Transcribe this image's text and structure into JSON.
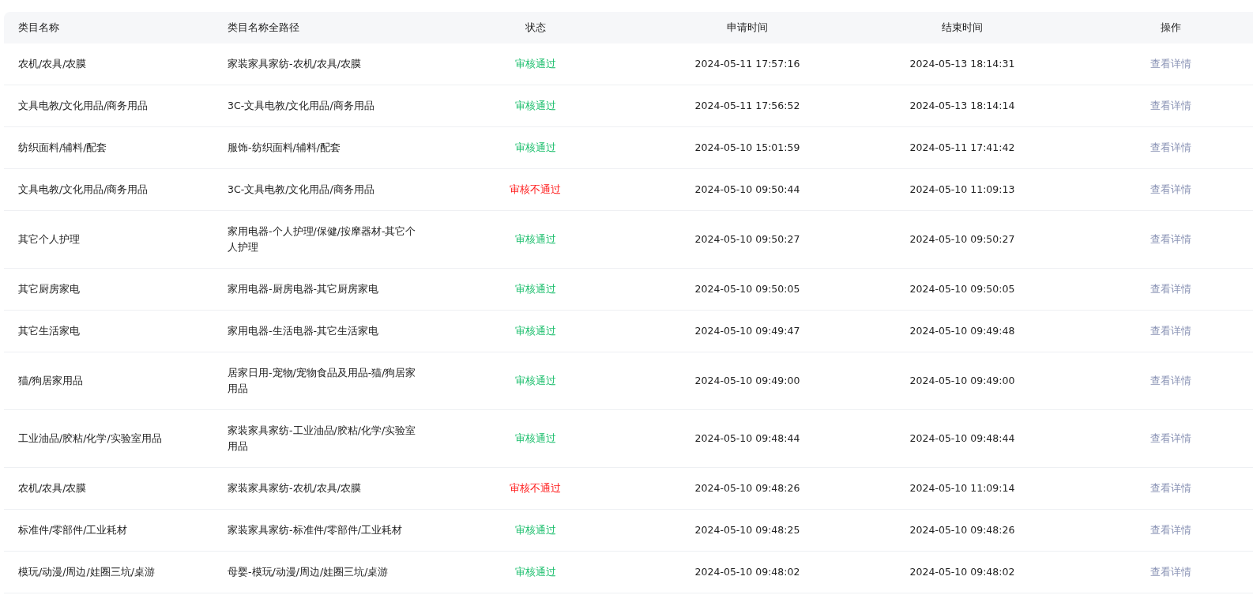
{
  "table": {
    "columns": [
      "类目名称",
      "类目名称全路径",
      "状态",
      "申请时间",
      "结束时间",
      "操作"
    ],
    "rows": [
      {
        "name": "农机/农具/农膜",
        "path": "家装家具家纺-农机/农具/农膜",
        "status": {
          "text": "审核通过",
          "kind": "approved"
        },
        "applied": "2024-05-11 17:57:16",
        "ended": "2024-05-13 18:14:31",
        "action": "查看详情"
      },
      {
        "name": "文具电教/文化用品/商务用品",
        "path": "3C-文具电教/文化用品/商务用品",
        "status": {
          "text": "审核通过",
          "kind": "approved"
        },
        "applied": "2024-05-11 17:56:52",
        "ended": "2024-05-13 18:14:14",
        "action": "查看详情"
      },
      {
        "name": "纺织面料/辅料/配套",
        "path": "服饰-纺织面料/辅料/配套",
        "status": {
          "text": "审核通过",
          "kind": "approved"
        },
        "applied": "2024-05-10 15:01:59",
        "ended": "2024-05-11 17:41:42",
        "action": "查看详情"
      },
      {
        "name": "文具电教/文化用品/商务用品",
        "path": "3C-文具电教/文化用品/商务用品",
        "status": {
          "text": "审核不通过",
          "kind": "rejected"
        },
        "applied": "2024-05-10 09:50:44",
        "ended": "2024-05-10 11:09:13",
        "action": "查看详情"
      },
      {
        "name": "其它个人护理",
        "path": "家用电器-个人护理/保健/按摩器材-其它个人护理",
        "status": {
          "text": "审核通过",
          "kind": "approved"
        },
        "applied": "2024-05-10 09:50:27",
        "ended": "2024-05-10 09:50:27",
        "action": "查看详情"
      },
      {
        "name": "其它厨房家电",
        "path": "家用电器-厨房电器-其它厨房家电",
        "status": {
          "text": "审核通过",
          "kind": "approved"
        },
        "applied": "2024-05-10 09:50:05",
        "ended": "2024-05-10 09:50:05",
        "action": "查看详情"
      },
      {
        "name": "其它生活家电",
        "path": "家用电器-生活电器-其它生活家电",
        "status": {
          "text": "审核通过",
          "kind": "approved"
        },
        "applied": "2024-05-10 09:49:47",
        "ended": "2024-05-10 09:49:48",
        "action": "查看详情"
      },
      {
        "name": "猫/狗居家用品",
        "path": "居家日用-宠物/宠物食品及用品-猫/狗居家用品",
        "status": {
          "text": "审核通过",
          "kind": "approved"
        },
        "applied": "2024-05-10 09:49:00",
        "ended": "2024-05-10 09:49:00",
        "action": "查看详情"
      },
      {
        "name": "工业油品/胶粘/化学/实验室用品",
        "path": "家装家具家纺-工业油品/胶粘/化学/实验室用品",
        "status": {
          "text": "审核通过",
          "kind": "approved"
        },
        "applied": "2024-05-10 09:48:44",
        "ended": "2024-05-10 09:48:44",
        "action": "查看详情"
      },
      {
        "name": "农机/农具/农膜",
        "path": "家装家具家纺-农机/农具/农膜",
        "status": {
          "text": "审核不通过",
          "kind": "rejected"
        },
        "applied": "2024-05-10 09:48:26",
        "ended": "2024-05-10 11:09:14",
        "action": "查看详情"
      },
      {
        "name": "标准件/零部件/工业耗材",
        "path": "家装家具家纺-标准件/零部件/工业耗材",
        "status": {
          "text": "审核通过",
          "kind": "approved"
        },
        "applied": "2024-05-10 09:48:25",
        "ended": "2024-05-10 09:48:26",
        "action": "查看详情"
      },
      {
        "name": "模玩/动漫/周边/娃圈三坑/桌游",
        "path": "母婴-模玩/动漫/周边/娃圈三坑/桌游",
        "status": {
          "text": "审核通过",
          "kind": "approved"
        },
        "applied": "2024-05-10 09:48:02",
        "ended": "2024-05-10 09:48:02",
        "action": "查看详情"
      }
    ]
  }
}
